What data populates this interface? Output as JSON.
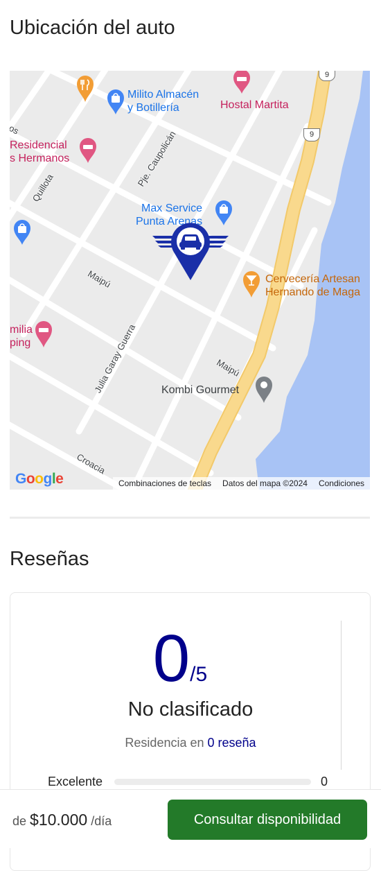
{
  "location": {
    "title": "Ubicación del auto",
    "map": {
      "pois": [
        {
          "text": "Milito Almacén\ny Botillería"
        },
        {
          "text": "Hostal Martita"
        },
        {
          "text": "Residencial\ns Hermanos"
        },
        {
          "text": "Max Service\nPunta Arenas"
        },
        {
          "text": "Cervecería Artesan\nHernando de Maga"
        },
        {
          "text": "milia\nping"
        },
        {
          "text": "Kombi Gourmet"
        }
      ],
      "streets": [
        "os",
        "Quillota",
        "Pje. Caupolicán",
        "Maipú",
        "Julia Garay Guerra",
        "Maipú",
        "Croacia"
      ],
      "route_shield": "9",
      "google_logo": "Google",
      "attribution": [
        "Combinaciones de teclas",
        "Datos del mapa ©2024",
        "Condiciones"
      ],
      "marker_icon": "car-location-pin-icon"
    }
  },
  "reviews": {
    "title": "Reseñas",
    "score": "0",
    "score_max": "/5",
    "rating_label": "No clasificado",
    "based_prefix": "Residencia en",
    "based_count": "0 reseña",
    "bars": [
      {
        "label": "Excelente",
        "value": "0",
        "fraction": 0
      }
    ]
  },
  "bottom_bar": {
    "price_prefix": "de",
    "price_amount": "$10.000",
    "price_suffix": "/día",
    "cta_label": "Consultar disponibilidad"
  },
  "colors": {
    "accent": "#00008b",
    "cta": "#237a29",
    "water": "#a8c3f5",
    "highway": "#f9d98d"
  }
}
